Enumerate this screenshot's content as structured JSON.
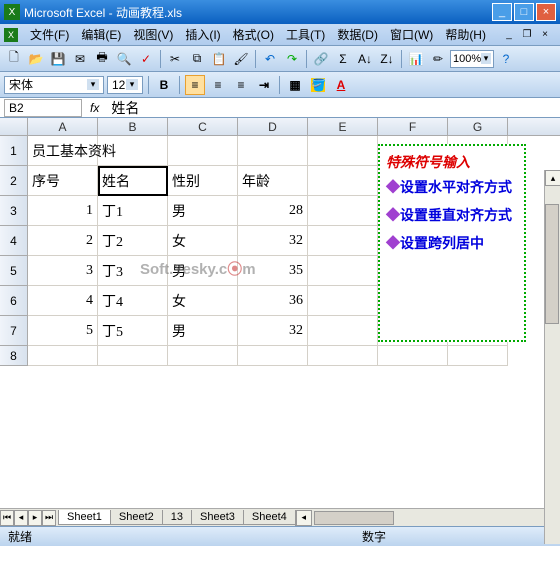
{
  "title": "Microsoft Excel - 动画教程.xls",
  "menus": [
    "文件(F)",
    "编辑(E)",
    "视图(V)",
    "插入(I)",
    "格式(O)",
    "工具(T)",
    "数据(D)",
    "窗口(W)",
    "帮助(H)"
  ],
  "zoom": "100%",
  "font": {
    "name": "宋体",
    "size": "12"
  },
  "namebox": "B2",
  "fx": "fx",
  "formula_value": "姓名",
  "columns": [
    "A",
    "B",
    "C",
    "D",
    "E",
    "F",
    "G"
  ],
  "headers": {
    "title": "员工基本资料",
    "A": "序号",
    "B": "姓名",
    "C": "性别",
    "D": "年龄"
  },
  "rows": [
    {
      "n": 1,
      "A": "1",
      "B": "丁1",
      "C": "男",
      "D": "28"
    },
    {
      "n": 2,
      "A": "2",
      "B": "丁2",
      "C": "女",
      "D": "32"
    },
    {
      "n": 3,
      "A": "3",
      "B": "丁3",
      "C": "男",
      "D": "35"
    },
    {
      "n": 4,
      "A": "4",
      "B": "丁4",
      "C": "女",
      "D": "36"
    },
    {
      "n": 5,
      "A": "5",
      "B": "丁5",
      "C": "男",
      "D": "32"
    }
  ],
  "row_labels": [
    "1",
    "2",
    "3",
    "4",
    "5",
    "6",
    "7",
    "8"
  ],
  "annotation": {
    "title": "特殊符号输入",
    "items": [
      "设置水平对齐方式",
      "设置垂直对齐方式",
      "设置跨列居中"
    ]
  },
  "tabs": [
    "Sheet1",
    "Sheet2",
    "13",
    "Sheet3",
    "Sheet4"
  ],
  "status_left": "就绪",
  "status_right": "数字",
  "watermark": "Soft.Yesky.c"
}
